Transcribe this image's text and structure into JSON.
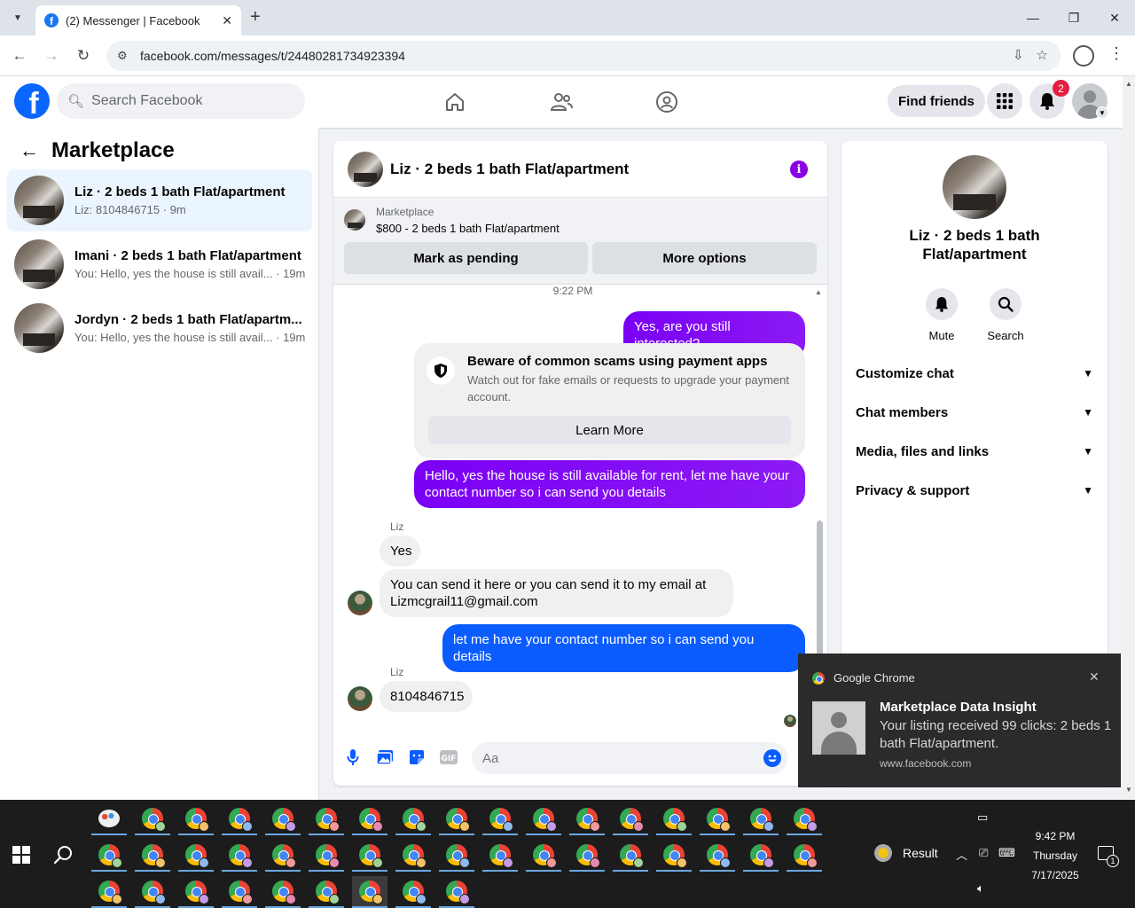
{
  "browser": {
    "tab_title": "(2) Messenger | Facebook",
    "url": "facebook.com/messages/t/24480281734923394"
  },
  "fb_header": {
    "search_placeholder": "Search Facebook",
    "find_friends_label": "Find friends",
    "notification_count": "2"
  },
  "sidebar": {
    "title": "Marketplace",
    "conversations": [
      {
        "name": "Liz · 2 beds 1 bath Flat/apartment",
        "preview": "Liz: 8104846715 · 9m",
        "active": true
      },
      {
        "name": "Imani · 2 beds 1 bath Flat/apartment",
        "preview": "You: Hello, yes the house is still avail... · 19m",
        "active": false
      },
      {
        "name": "Jordyn · 2 beds 1 bath Flat/apartm...",
        "preview": "You: Hello, yes the house is still avail... · 19m",
        "active": false
      }
    ]
  },
  "chat": {
    "title": "Liz · 2 beds 1 bath Flat/apartment",
    "marketplace_label": "Marketplace",
    "listing": "$800 - 2 beds 1 bath Flat/apartment",
    "mark_pending_label": "Mark as pending",
    "more_options_label": "More options",
    "timestamp": "9:22 PM",
    "messages": {
      "m1": "Yes, are you still interested?",
      "scam_title": "Beware of common scams using payment apps",
      "scam_body": "Watch out for fake emails or requests to upgrade your payment account.",
      "learn_more": "Learn More",
      "m2": "Hello, yes the house is still available for rent, let me have your contact number so i can send you details",
      "sender1": "Liz",
      "m3": "Yes",
      "m4": "You can send it here or you can send it to my email at Lizmcgrail11@gmail.com",
      "m5": "let me have your contact number so i can send you details",
      "sender2": "Liz",
      "m6": "8104846715"
    },
    "composer_placeholder": "Aa"
  },
  "info_panel": {
    "name": "Liz · 2 beds 1 bath Flat/apartment",
    "mute_label": "Mute",
    "search_label": "Search",
    "sections": [
      "Customize chat",
      "Chat members",
      "Media, files and links",
      "Privacy & support"
    ]
  },
  "toast": {
    "app": "Google Chrome",
    "title": "Marketplace Data Insight",
    "body": "Your listing received 99 clicks: 2 beds 1 bath Flat/apartment.",
    "source": "www.facebook.com"
  },
  "taskbar": {
    "weather_label": "Result",
    "time": "9:42 PM",
    "day": "Thursday",
    "date": "7/17/2025",
    "notification_count": "1"
  },
  "colors": {
    "fb_blue": "#0866ff",
    "messenger_purple": "#8a00e5",
    "outgoing_blue": "#0a5cff"
  }
}
